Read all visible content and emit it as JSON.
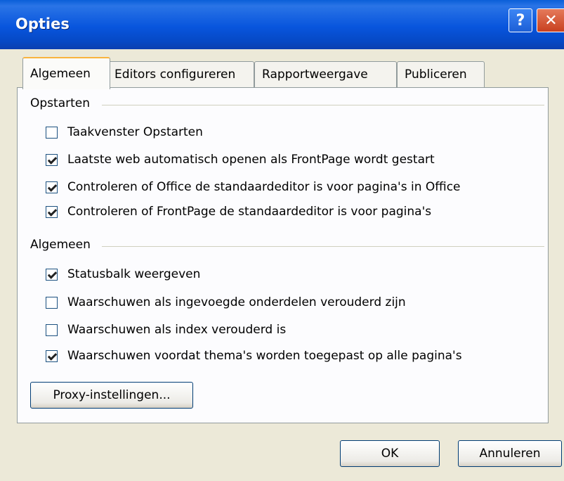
{
  "window": {
    "title": "Opties",
    "help_label": "?",
    "close_label": "✕"
  },
  "tabs": [
    {
      "label": "Algemeen",
      "active": true
    },
    {
      "label": "Editors configureren",
      "active": false
    },
    {
      "label": "Rapportweergave",
      "active": false
    },
    {
      "label": "Publiceren",
      "active": false
    }
  ],
  "groups": {
    "startup": {
      "title": "Opstarten",
      "items": [
        {
          "label": "Taakvenster Opstarten",
          "checked": false
        },
        {
          "label": "Laatste web automatisch openen als FrontPage wordt gestart",
          "checked": true
        },
        {
          "label": "Controleren of Office de standaardeditor is voor pagina's in Office",
          "checked": true
        },
        {
          "label": "Controleren of FrontPage de standaardeditor is voor pagina's",
          "checked": true
        }
      ]
    },
    "general": {
      "title": "Algemeen",
      "items": [
        {
          "label": "Statusbalk weergeven",
          "checked": true
        },
        {
          "label": "Waarschuwen als ingevoegde onderdelen verouderd zijn",
          "checked": false
        },
        {
          "label": "Waarschuwen als index verouderd is",
          "checked": false
        },
        {
          "label": "Waarschuwen voordat thema's worden toegepast op alle pagina's",
          "checked": true
        }
      ]
    }
  },
  "proxy_button": "Proxy-instellingen...",
  "buttons": {
    "ok": "OK",
    "cancel": "Annuleren"
  }
}
